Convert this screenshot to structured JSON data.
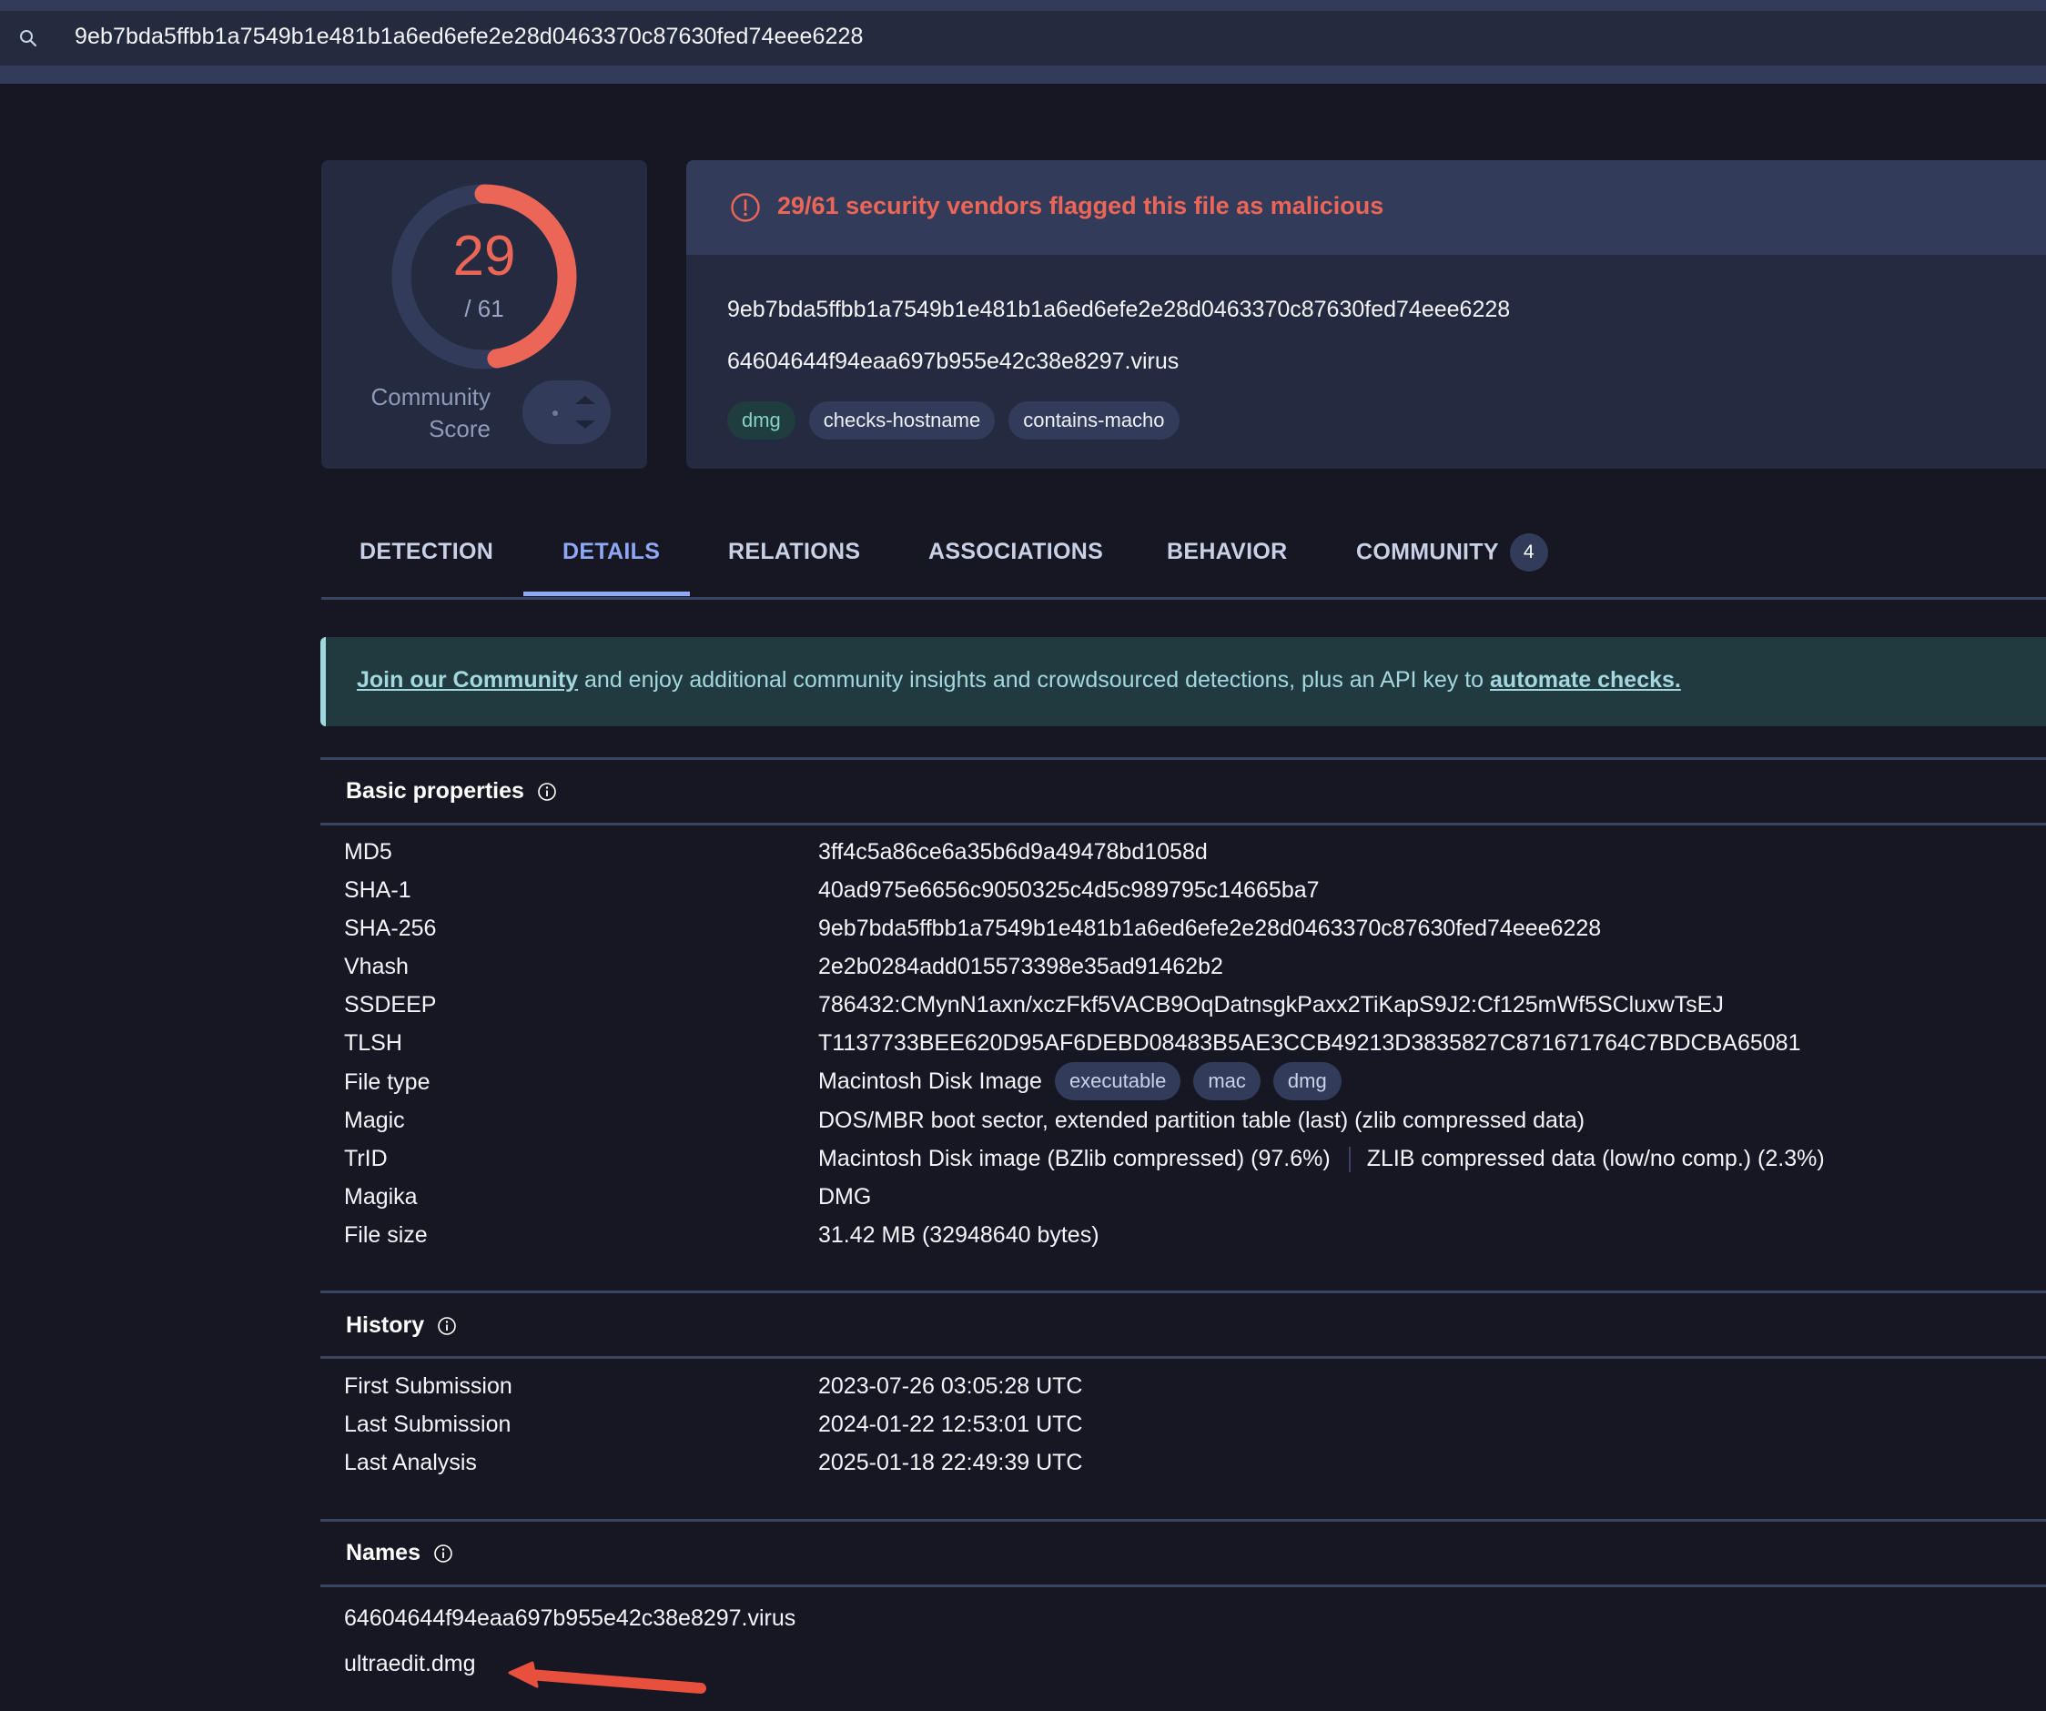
{
  "search": {
    "icon": "search-icon",
    "value": "9eb7bda5ffbb1a7549b1e481b1a6ed6efe2e28d0463370c87630fed74eee6228"
  },
  "score": {
    "detections": "29",
    "total": "/ 61",
    "detection_fraction": 0.4754,
    "community_label_line1": "Community",
    "community_label_line2": "Score"
  },
  "alert": {
    "icon": "alert-circle-icon",
    "message": "29/61 security vendors flagged this file as malicious",
    "file_hash": "9eb7bda5ffbb1a7549b1e481b1a6ed6efe2e28d0463370c87630fed74eee6228",
    "file_name": "64604644f94eaa697b955e42c38e8297.virus",
    "tags": [
      "dmg",
      "checks-hostname",
      "contains-macho"
    ]
  },
  "tabs": [
    {
      "label": "DETECTION",
      "active": false
    },
    {
      "label": "DETAILS",
      "active": true
    },
    {
      "label": "RELATIONS",
      "active": false
    },
    {
      "label": "ASSOCIATIONS",
      "active": false
    },
    {
      "label": "BEHAVIOR",
      "active": false
    },
    {
      "label": "COMMUNITY",
      "active": false,
      "badge": "4"
    }
  ],
  "banner": {
    "link1": "Join our Community",
    "middle": " and enjoy additional community insights and crowdsourced detections, plus an API key to ",
    "link2": "automate checks."
  },
  "basic_properties": {
    "title": "Basic properties",
    "rows": [
      {
        "label": "MD5",
        "value": "3ff4c5a86ce6a35b6d9a49478bd1058d"
      },
      {
        "label": "SHA-1",
        "value": "40ad975e6656c9050325c4d5c989795c14665ba7"
      },
      {
        "label": "SHA-256",
        "value": "9eb7bda5ffbb1a7549b1e481b1a6ed6efe2e28d0463370c87630fed74eee6228"
      },
      {
        "label": "Vhash",
        "value": "2e2b0284add015573398e35ad91462b2"
      },
      {
        "label": "SSDEEP",
        "value": "786432:CMynN1axn/xczFkf5VACB9OqDatnsgkPaxx2TiKapS9J2:Cf125mWf5SCluxwTsEJ"
      },
      {
        "label": "TLSH",
        "value": "T1137733BEE620D95AF6DEBD08483B5AE3CCB49213D3835827C871671764C7BDCBA65081"
      },
      {
        "label": "File type",
        "value": "Macintosh Disk Image",
        "tags": [
          "executable",
          "mac",
          "dmg"
        ]
      },
      {
        "label": "Magic",
        "value": "DOS/MBR boot sector, extended partition table (last) (zlib compressed data)"
      },
      {
        "label": "TrID",
        "value": "Macintosh Disk image (BZlib compressed) (97.6%)",
        "value2": "ZLIB compressed data (low/no comp.) (2.3%)"
      },
      {
        "label": "Magika",
        "value": "DMG"
      },
      {
        "label": "File size",
        "value": "31.42 MB (32948640 bytes)"
      }
    ]
  },
  "history": {
    "title": "History",
    "rows": [
      {
        "label": "First Submission",
        "value": "2023-07-26 03:05:28 UTC"
      },
      {
        "label": "Last Submission",
        "value": "2024-01-22 12:53:01 UTC"
      },
      {
        "label": "Last Analysis",
        "value": "2025-01-18 22:49:39 UTC"
      }
    ]
  },
  "names": {
    "title": "Names",
    "items": [
      "64604644f94eaa697b955e42c38e8297.virus",
      "ultraedit.dmg"
    ]
  },
  "colors": {
    "malicious": "#ec6657",
    "accent": "#8fa8f5",
    "annotation_arrow": "#e84f3d"
  }
}
